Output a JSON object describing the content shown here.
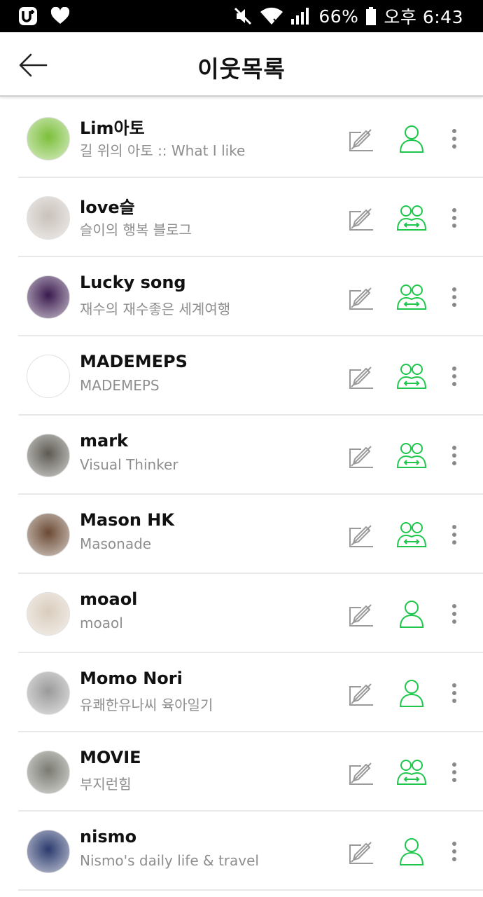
{
  "status_bar": {
    "battery": "66%",
    "time": "오후 6:43",
    "icons": [
      "u-plus-icon",
      "heart-icon",
      "mute-icon",
      "wifi-icon",
      "signal-icon",
      "battery-icon"
    ]
  },
  "header": {
    "title": "이웃목록",
    "back_icon": "arrow-left-icon"
  },
  "colors": {
    "accent": "#1ec74b",
    "name_text": "#111111",
    "desc_text": "#8e8e8e",
    "divider": "#e8e8e8"
  },
  "neighbors": [
    {
      "name": "Lim아토",
      "desc": "길 위의 아토 :: What I like",
      "relation": "single",
      "avatar": "#7bbf3a"
    },
    {
      "name": "love슬",
      "desc": "슬이의 행복 블로그",
      "relation": "mutual",
      "avatar": "#c9c1ba"
    },
    {
      "name": "Lucky song",
      "desc": "재수의 재수좋은 세계여행",
      "relation": "mutual",
      "avatar": "#3a1a4e"
    },
    {
      "name": "MADEMEPS",
      "desc": "MADEMEPS",
      "relation": "mutual",
      "avatar": "#ffffff"
    },
    {
      "name": "mark",
      "desc": "Visual Thinker",
      "relation": "mutual",
      "avatar": "#5d5a52"
    },
    {
      "name": "Mason HK",
      "desc": "Masonade",
      "relation": "mutual",
      "avatar": "#6b4a34"
    },
    {
      "name": "moaol",
      "desc": "moaol",
      "relation": "single",
      "avatar": "#d9ccbd"
    },
    {
      "name": "Momo Nori",
      "desc": "유쾌한유나씨 육아일기",
      "relation": "single",
      "avatar": "#9a9a9a"
    },
    {
      "name": "MOVIE",
      "desc": "부지런힘",
      "relation": "mutual",
      "avatar": "#7a7a72"
    },
    {
      "name": "nismo",
      "desc": "Nismo's daily life & travel",
      "relation": "single",
      "avatar": "#2b3a6e"
    }
  ]
}
